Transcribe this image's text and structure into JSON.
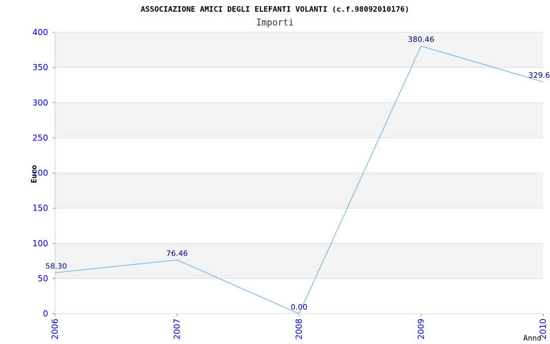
{
  "chart_data": {
    "type": "line",
    "title": "ASSOCIAZIONE AMICI DEGLI ELEFANTI VOLANTI (c.f.98092010176)",
    "subtitle": "Importi",
    "xlabel": "Anno",
    "ylabel": "Euro",
    "categories": [
      "2006",
      "2007",
      "2008",
      "2009",
      "2010"
    ],
    "ylim": [
      0,
      400
    ],
    "yticks": [
      "0",
      "50",
      "100",
      "150",
      "200",
      "250",
      "300",
      "350",
      "400"
    ],
    "series": [
      {
        "values": [
          58.3,
          76.46,
          0.0,
          380.46,
          329.6
        ],
        "labels": [
          "58.30",
          "76.46",
          "0.00",
          "380.46",
          "329.6"
        ]
      }
    ],
    "grid": true,
    "colors": {
      "line": "#6aaee8",
      "tick_text": "#0000bb",
      "data_label": "#00007a",
      "band": "#f3f3f3",
      "grid": "#dedede"
    }
  }
}
